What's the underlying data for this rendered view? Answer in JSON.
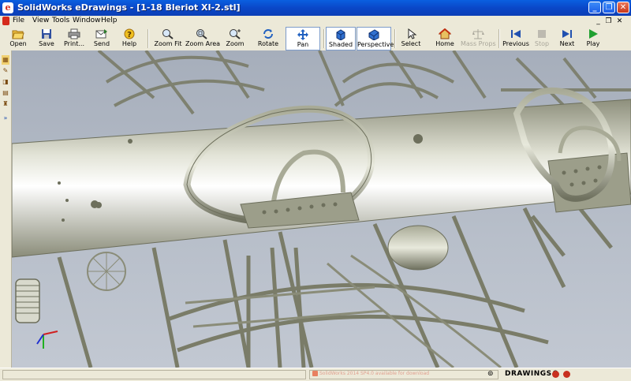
{
  "window": {
    "title": "SolidWorks eDrawings - [1-18 Bleriot XI-2.stl]",
    "app_icon": "eDrawings-app-icon",
    "controls": [
      "minimize",
      "maximize",
      "close"
    ]
  },
  "menu": [
    {
      "label": "File"
    },
    {
      "label": "View"
    },
    {
      "label": "Tools"
    },
    {
      "label": "Window"
    },
    {
      "label": "Help"
    }
  ],
  "toolbar": [
    {
      "label": "Open",
      "icon": "open-folder-icon"
    },
    {
      "label": "Save",
      "icon": "save-disk-icon"
    },
    {
      "label": "Print...",
      "icon": "printer-icon"
    },
    {
      "label": "Send",
      "icon": "send-mail-icon"
    },
    {
      "label": "Help",
      "icon": "help-question-icon"
    },
    {
      "label": "Zoom Fit",
      "icon": "zoom-fit-icon"
    },
    {
      "label": "Zoom Area",
      "icon": "zoom-area-icon"
    },
    {
      "label": "Zoom",
      "icon": "zoom-icon"
    },
    {
      "label": "Rotate",
      "icon": "rotate-icon"
    },
    {
      "label": "Pan",
      "icon": "pan-icon",
      "pressed": true
    },
    {
      "label": "Shaded",
      "icon": "shaded-cube-icon",
      "pressed": true
    },
    {
      "label": "Perspective",
      "icon": "perspective-cube-icon",
      "pressed": true
    },
    {
      "label": "Select",
      "icon": "select-arrow-icon"
    },
    {
      "label": "Home",
      "icon": "home-icon"
    },
    {
      "label": "Mass Props",
      "icon": "scale-icon",
      "disabled": true
    },
    {
      "label": "Previous",
      "icon": "previous-icon"
    },
    {
      "label": "Stop",
      "icon": "stop-icon",
      "disabled": true
    },
    {
      "label": "Next",
      "icon": "next-icon"
    },
    {
      "label": "Play",
      "icon": "play-icon"
    }
  ],
  "sidebar_icons": [
    "components-icon",
    "markup-icon",
    "measure-icon",
    "configurations-icon",
    "stamp-icon",
    "expand-icon"
  ],
  "status": {
    "watermark": "SolidWorks 2014 SP4.0 available for download",
    "brand": "DRAWINGS®",
    "colors": {
      "accent": "#0a5fe0",
      "toolbar": "#ece9d8",
      "viewport": "#b0b7c3"
    }
  }
}
